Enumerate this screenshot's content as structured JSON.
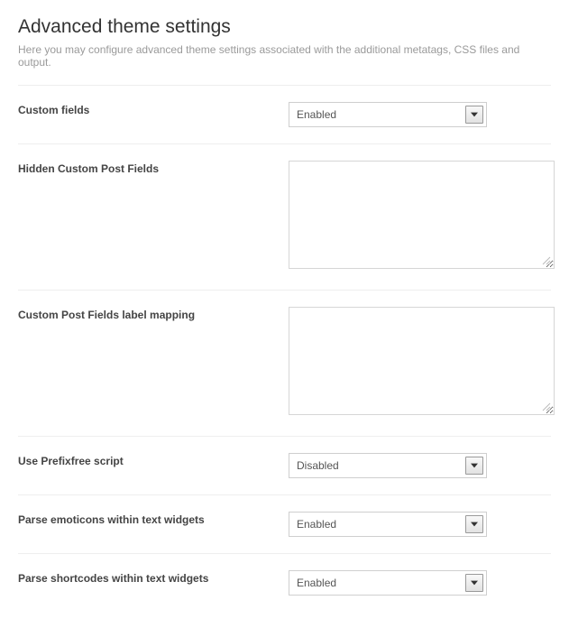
{
  "header": {
    "title": "Advanced theme settings",
    "subtitle": "Here you may configure advanced theme settings associated with the additional metatags, CSS files and output."
  },
  "rows": {
    "customFields": {
      "label": "Custom fields",
      "value": "Enabled"
    },
    "hiddenCustomPostFields": {
      "label": "Hidden Custom Post Fields",
      "value": ""
    },
    "labelMapping": {
      "label": "Custom Post Fields label mapping",
      "value": ""
    },
    "prefixfree": {
      "label": "Use Prefixfree script",
      "value": "Disabled"
    },
    "emoticons": {
      "label": "Parse emoticons within text widgets",
      "value": "Enabled"
    },
    "shortcodes": {
      "label": "Parse shortcodes within text widgets",
      "value": "Enabled"
    }
  }
}
